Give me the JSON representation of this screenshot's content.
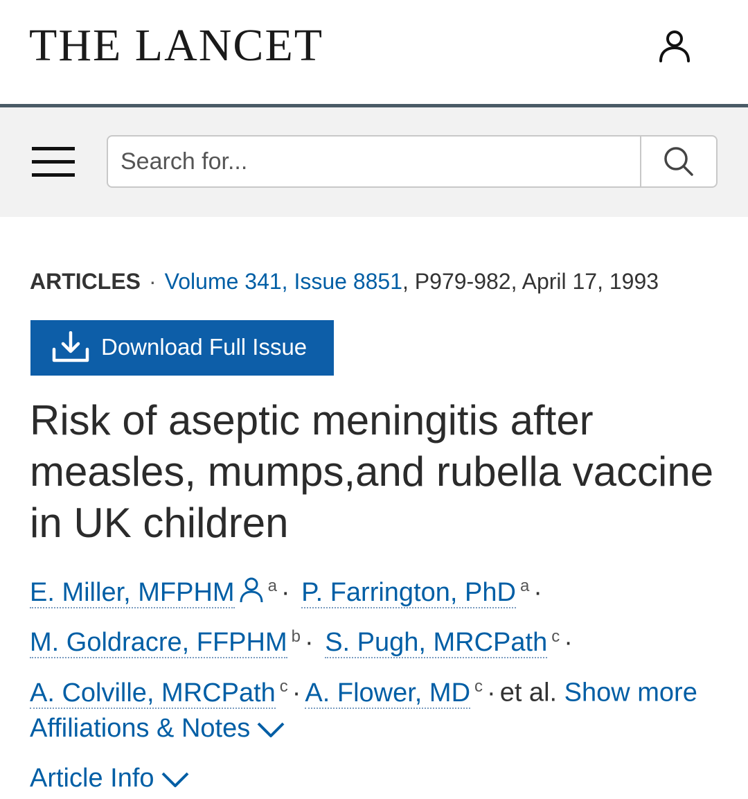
{
  "header": {
    "logo": "THE LANCET",
    "user_icon": "user-icon"
  },
  "search": {
    "menu_icon": "hamburger-menu-icon",
    "placeholder": "Search for...",
    "submit_icon": "search-icon"
  },
  "article": {
    "type": "ARTICLES",
    "volume_issue": "Volume 341, Issue 8851",
    "pages_date": ", P979-982, April 17, 1993",
    "download_label": "Download Full Issue",
    "download_icon": "download-icon",
    "title": "Risk of aseptic meningitis after measles, mumps,and rubella vaccine in UK children",
    "authors": [
      {
        "name": "E. Miller, MFPHM",
        "affil": "a",
        "corresponding": true
      },
      {
        "name": "P. Farrington, PhD",
        "affil": "a"
      },
      {
        "name": "M. Goldracre, FFPHM",
        "affil": "b"
      },
      {
        "name": "S. Pugh, MRCPath",
        "affil": "c"
      },
      {
        "name": "A. Colville, MRCPath",
        "affil": "c"
      },
      {
        "name": "A. Flower, MD",
        "affil": "c"
      }
    ],
    "et_al": "et al.",
    "show_more": "Show more",
    "affiliations_label": "Affiliations & Notes",
    "article_info_label": "Article Info"
  },
  "colors": {
    "link": "#005ea5",
    "button": "#0d5ea8",
    "divider": "#4a5b66",
    "search_band": "#f2f2f2"
  }
}
